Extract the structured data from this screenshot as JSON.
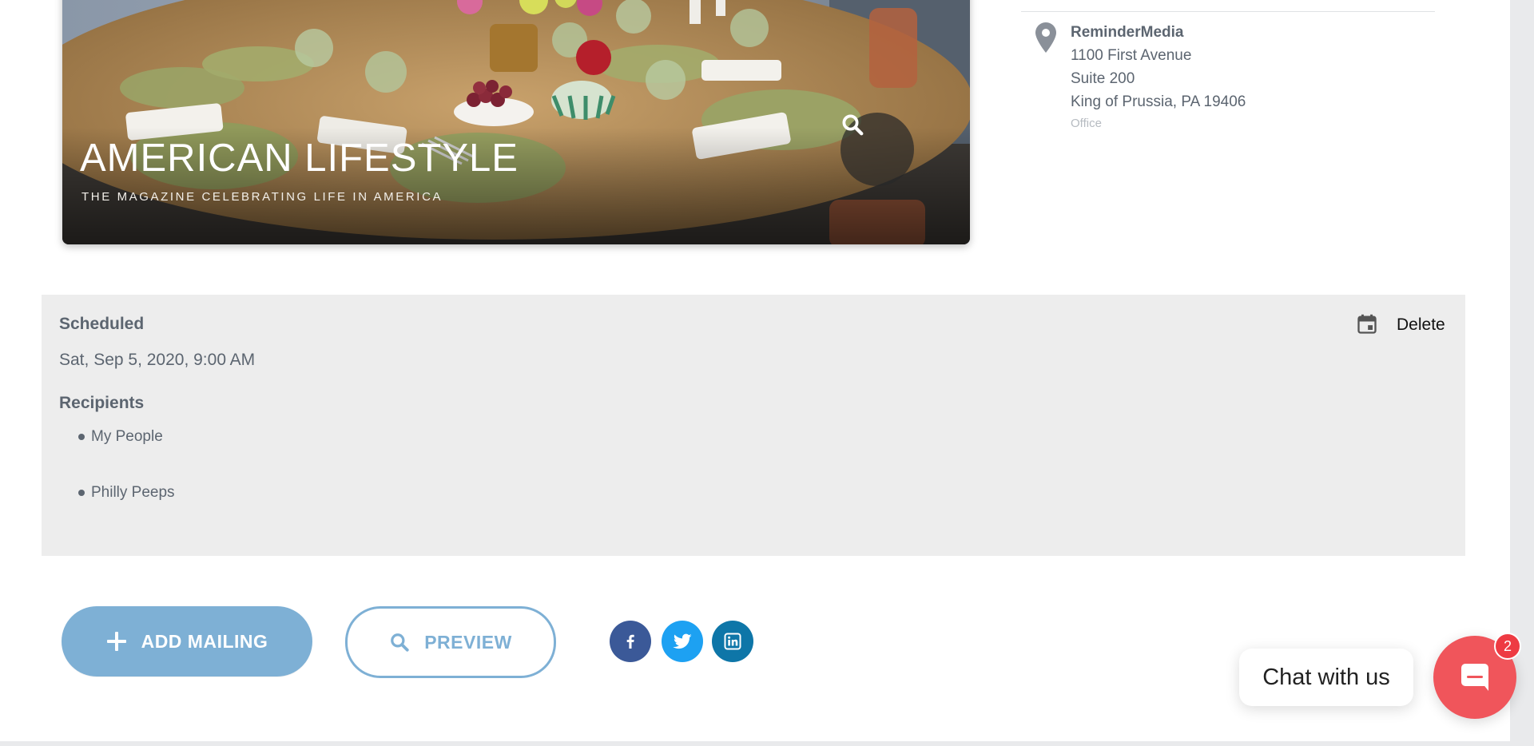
{
  "magazine": {
    "title": "AMERICAN LIFESTYLE",
    "subtitle": "THE MAGAZINE CELEBRATING LIFE IN AMERICA",
    "zoom_icon": "search-icon"
  },
  "address": {
    "icon": "map-pin-icon",
    "name": "ReminderMedia",
    "line1": "1100 First Avenue",
    "line2": "Suite 200",
    "line3": "King of Prussia, PA 19406",
    "type": "Office"
  },
  "schedule": {
    "scheduled_label": "Scheduled",
    "date": "Sat, Sep 5, 2020, 9:00 AM",
    "recipients_label": "Recipients",
    "recipients": [
      "My People",
      "Philly Peeps"
    ],
    "calendar_icon": "calendar-icon",
    "delete_label": "Delete"
  },
  "actions": {
    "add_mailing_label": "ADD MAILING",
    "preview_label": "PREVIEW"
  },
  "social": {
    "icons": [
      "facebook-icon",
      "twitter-icon",
      "linkedin-icon"
    ]
  },
  "chat": {
    "label": "Chat with us",
    "badge_count": "2",
    "icon": "chat-bubble-icon"
  },
  "colors": {
    "accent": "#7eb0d5",
    "panel_bg": "#ededed",
    "chat_red": "#f0555b",
    "facebook": "#3b5998",
    "twitter": "#1da1f2",
    "linkedin": "#0e76a8"
  }
}
